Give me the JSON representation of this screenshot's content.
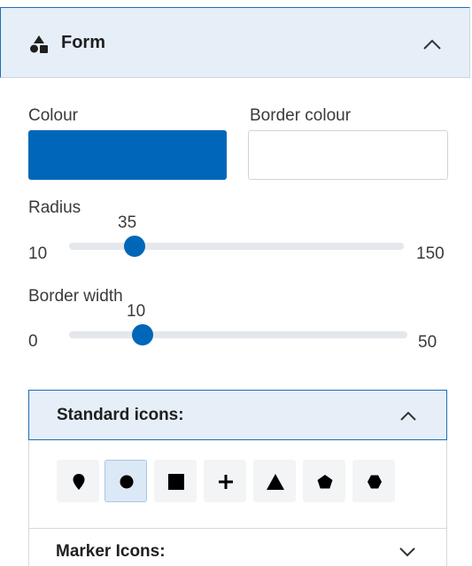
{
  "header": {
    "title": "Form",
    "icon": "shapes-icon",
    "expanded": true
  },
  "colour": {
    "label": "Colour",
    "value": "#0067b8"
  },
  "border_colour": {
    "label": "Border colour",
    "value": "#ffffff"
  },
  "radius": {
    "label": "Radius",
    "min": "10",
    "max": "150",
    "value": "35"
  },
  "border_width": {
    "label": "Border width",
    "min": "0",
    "max": "50",
    "value": "10"
  },
  "standard_icons": {
    "title": "Standard icons:",
    "expanded": true,
    "icons": [
      {
        "name": "pin-icon",
        "selected": false
      },
      {
        "name": "circle-icon",
        "selected": true
      },
      {
        "name": "square-icon",
        "selected": false
      },
      {
        "name": "plus-icon",
        "selected": false
      },
      {
        "name": "triangle-icon",
        "selected": false
      },
      {
        "name": "pentagon-icon",
        "selected": false
      },
      {
        "name": "hexagon-icon",
        "selected": false
      }
    ]
  },
  "marker_icons": {
    "title": "Marker Icons:",
    "expanded": false
  },
  "colors": {
    "accent": "#0067b8",
    "header_bg": "#e6eff8"
  }
}
